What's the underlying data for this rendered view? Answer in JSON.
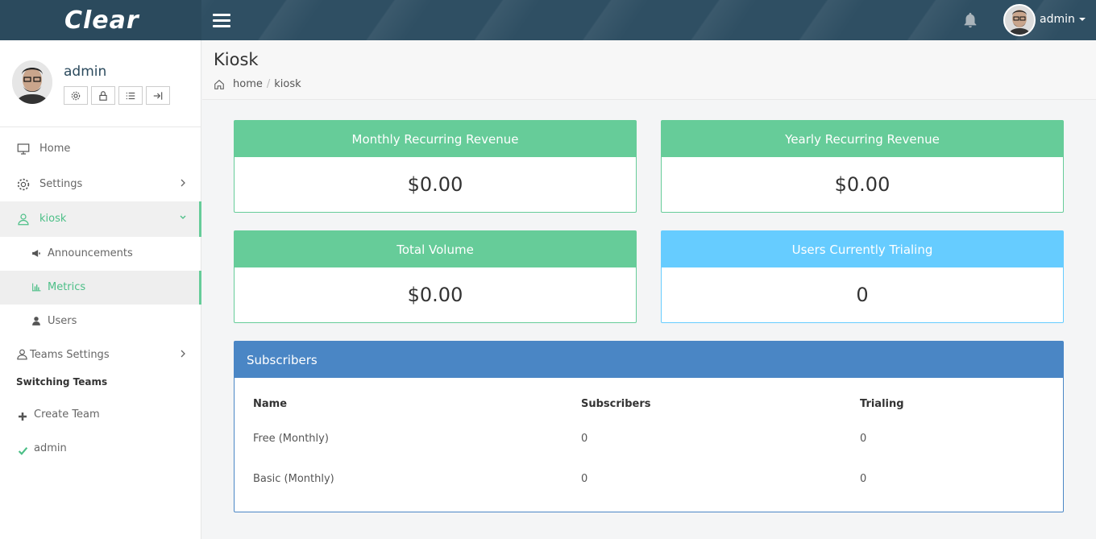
{
  "brand": "Clear",
  "top_user": "admin",
  "profile": {
    "name": "admin"
  },
  "nav": {
    "home": "Home",
    "settings": "Settings",
    "kiosk": "kiosk",
    "announcements": "Announcements",
    "metrics": "Metrics",
    "users": "Users",
    "teams_settings": "Teams Settings",
    "switching_teams": "Switching Teams",
    "create_team": "Create Team",
    "team_admin": "admin"
  },
  "page": {
    "title": "Kiosk",
    "breadcrumb": [
      "home",
      "kiosk"
    ]
  },
  "cards": [
    {
      "title": "Monthly Recurring Revenue",
      "value": "$0.00",
      "color": "#66cc99"
    },
    {
      "title": "Yearly Recurring Revenue",
      "value": "$0.00",
      "color": "#66cc99"
    },
    {
      "title": "Total Volume",
      "value": "$0.00",
      "color": "#66cc99"
    },
    {
      "title": "Users Currently Trialing",
      "value": "0",
      "color": "#66ccff"
    }
  ],
  "subscribers": {
    "title": "Subscribers",
    "headers": [
      "Name",
      "Subscribers",
      "Trialing"
    ],
    "rows": [
      [
        "Free (Monthly)",
        "0",
        "0"
      ],
      [
        "Basic (Monthly)",
        "0",
        "0"
      ]
    ]
  },
  "icons": {
    "bell": "bell-icon",
    "home": "monitor-icon",
    "settings": "gear-icon",
    "kiosk": "user-outline-icon",
    "announcements": "megaphone-icon",
    "metrics": "bar-chart-icon",
    "users": "user-icon",
    "teams": "user-outline-icon",
    "create": "plus-icon",
    "check": "check-icon"
  },
  "colors": {
    "accent_green": "#66cc99",
    "accent_blue": "#66ccff",
    "panel_blue": "#4a86c5",
    "topbar": "#2f4f63"
  }
}
